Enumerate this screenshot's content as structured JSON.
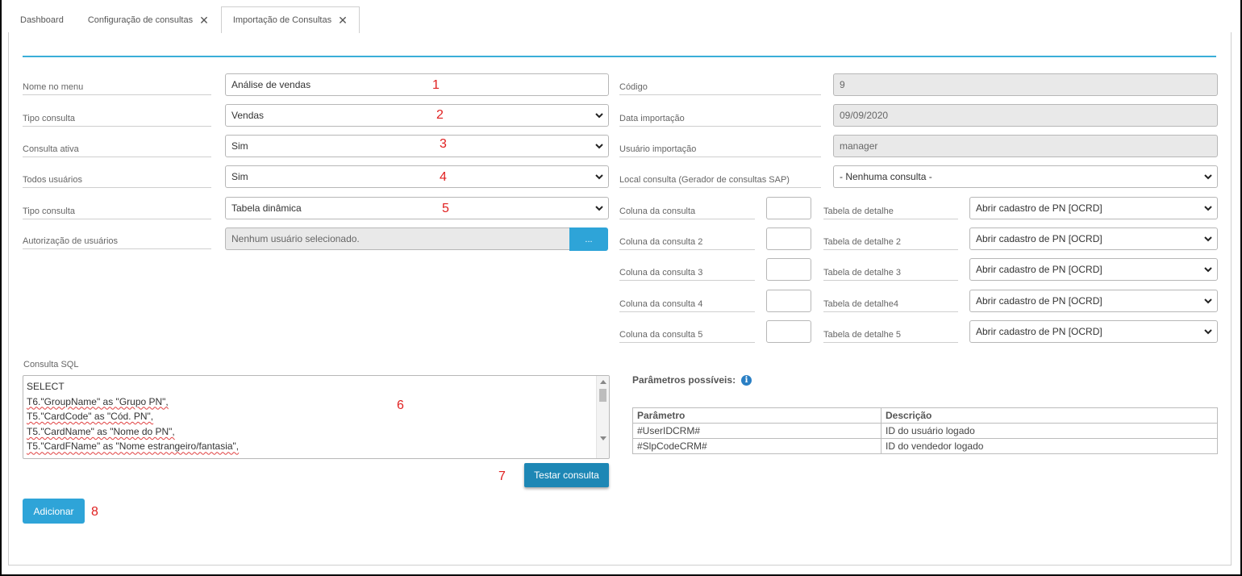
{
  "tabs": [
    {
      "label": "Dashboard",
      "closable": false,
      "active": false
    },
    {
      "label": "Configuração de consultas",
      "closable": true,
      "active": false
    },
    {
      "label": "Importação de Consultas",
      "closable": true,
      "active": true
    }
  ],
  "left_form": {
    "nome_menu": {
      "label": "Nome no menu",
      "value": "Análise de vendas"
    },
    "tipo_consulta": {
      "label": "Tipo consulta",
      "value": "Vendas"
    },
    "consulta_ativa": {
      "label": "Consulta ativa",
      "value": "Sim"
    },
    "todos_usuarios": {
      "label": "Todos usuários",
      "value": "Sim"
    },
    "tipo_consulta_2": {
      "label": "Tipo consulta",
      "value": "Tabela dinâmica"
    },
    "autorizacao": {
      "label": "Autorização de usuários",
      "value": "Nenhum usuário selecionado.",
      "button": "..."
    }
  },
  "right_form": {
    "codigo": {
      "label": "Código",
      "value": "9"
    },
    "data_importacao": {
      "label": "Data importação",
      "value": "09/09/2020"
    },
    "usuario_importacao": {
      "label": "Usuário importação",
      "value": "manager"
    },
    "local_consulta": {
      "label": "Local consulta (Gerador de consultas SAP)",
      "value": "- Nenhuma consulta -"
    }
  },
  "detail_rows": [
    {
      "coluna_label": "Coluna da consulta",
      "coluna_value": "",
      "tabela_label": "Tabela de detalhe",
      "tabela_value": "Abrir cadastro de PN [OCRD]"
    },
    {
      "coluna_label": "Coluna da consulta 2",
      "coluna_value": "",
      "tabela_label": "Tabela de detalhe 2",
      "tabela_value": "Abrir cadastro de PN [OCRD]"
    },
    {
      "coluna_label": "Coluna da consulta 3",
      "coluna_value": "",
      "tabela_label": "Tabela de detalhe 3",
      "tabela_value": "Abrir cadastro de PN [OCRD]"
    },
    {
      "coluna_label": "Coluna da consulta 4",
      "coluna_value": "",
      "tabela_label": "Tabela de detalhe4",
      "tabela_value": "Abrir cadastro de PN [OCRD]"
    },
    {
      "coluna_label": "Coluna da consulta 5",
      "coluna_value": "",
      "tabela_label": "Tabela de detalhe 5",
      "tabela_value": "Abrir cadastro de PN [OCRD]"
    }
  ],
  "sql": {
    "label": "Consulta SQL",
    "lines": [
      "SELECT",
      "T6.\"GroupName\" as \"Grupo PN\",",
      "T5.\"CardCode\" as \"Cód. PN\",",
      "T5.\"CardName\" as \"Nome do PN\",",
      "T5.\"CardFName\" as \"Nome estrangeiro/fantasia\","
    ]
  },
  "buttons": {
    "testar": "Testar consulta",
    "adicionar": "Adicionar"
  },
  "params": {
    "title": "Parâmetros possíveis:",
    "headers": [
      "Parâmetro",
      "Descrição"
    ],
    "rows": [
      [
        "#UserIDCRM#",
        "ID do usuário logado"
      ],
      [
        "#SlpCodeCRM#",
        "ID do vendedor logado"
      ]
    ]
  },
  "annotations": [
    "1",
    "2",
    "3",
    "4",
    "5",
    "6",
    "7",
    "8"
  ],
  "colors": {
    "accent": "#2ea4d8",
    "accent_dark": "#1d87b5",
    "annotation": "#e02020",
    "readonly_bg": "#e9e9e9"
  }
}
